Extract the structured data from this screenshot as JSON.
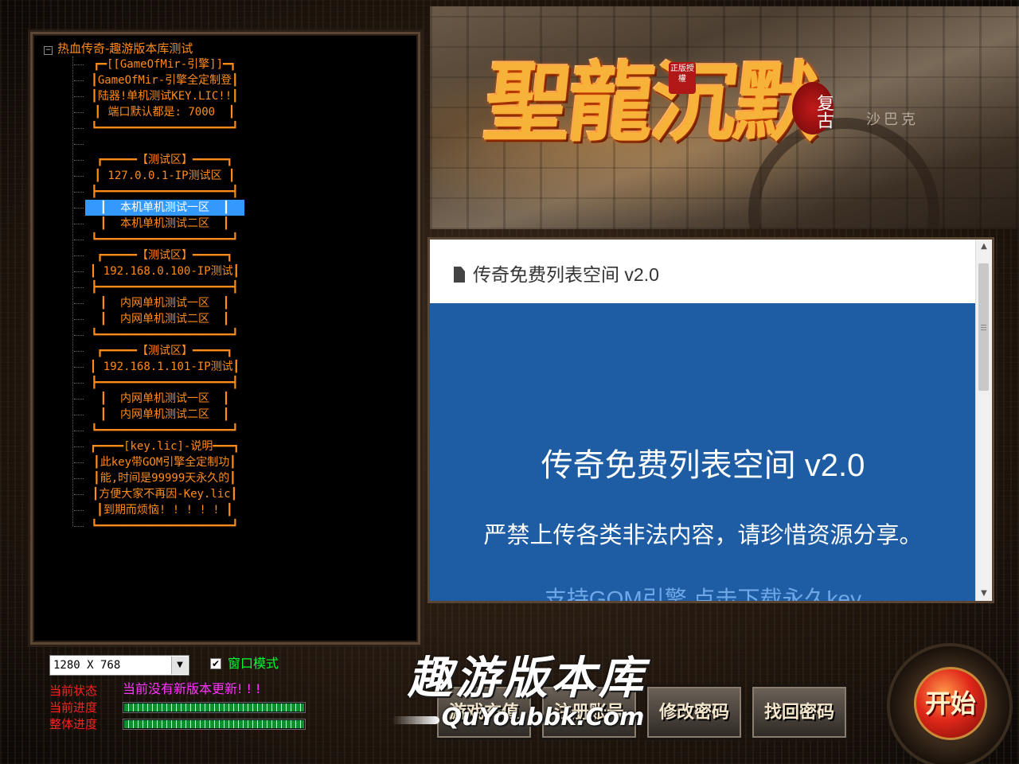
{
  "window": {
    "minimize_glyph": "◻",
    "close_glyph": "✕"
  },
  "tree": {
    "root_label": "热血传奇-趣游版本库测试",
    "expand_glyph": "−",
    "nodes": [
      "┏━[[GameOfMir-引擎]]━┓",
      "┃GameOfMir-引擎全定制登┃",
      "┃陆器!单机测试KEY.LIC!!┃",
      "┃ 端口默认都是: 7000  ┃",
      "┗━━━━━━━━━━━━━━━━━━━━┛",
      "",
      "┏━━━━━【测试区】━━━━━┓",
      "┃ 127.0.0.1-IP测试区 ┃",
      "┣━━━━━━━━━━━━━━━━━━━━┫",
      "┃  本机单机测试一区  ┃",
      "┃  本机单机测试二区  ┃",
      "┗━━━━━━━━━━━━━━━━━━━━┛",
      "┏━━━━━【测试区】━━━━━┓",
      "┃ 192.168.0.100-IP测试┃",
      "┣━━━━━━━━━━━━━━━━━━━━┫",
      "┃  内网单机测试一区  ┃",
      "┃  内网单机测试二区  ┃",
      "┗━━━━━━━━━━━━━━━━━━━━┛",
      "┏━━━━━【测试区】━━━━━┓",
      "┃ 192.168.1.101-IP测试┃",
      "┣━━━━━━━━━━━━━━━━━━━━┫",
      "┃  内网单机测试一区  ┃",
      "┃  内网单机测试二区  ┃",
      "┗━━━━━━━━━━━━━━━━━━━━┛",
      "┏━━━━[key.lic]-说明━━━┓",
      "┃此key带GOM引擎全定制功┃",
      "┃能,时间是99999天永久的┃",
      "┃方便大家不再因-Key.lic┃",
      "┃到期而烦恼! ! ! ! ! ┃",
      "┗━━━━━━━━━━━━━━━━━━━━┛"
    ],
    "selected_index": 9
  },
  "banner": {
    "game_title": "聖龍沉默",
    "title_tag": "正版授權",
    "title_sub": "复古",
    "sign_text": "沙巴克"
  },
  "web": {
    "header_title": "传奇免费列表空间 v2.0",
    "hero_title": "传奇免费列表空间 v2.0",
    "hero_subtitle": "严禁上传各类非法内容，请珍惜资源分享。",
    "hero_link": "支持GOM引擎 点击下载永久key",
    "scroll_up_glyph": "▲",
    "scroll_down_glyph": "▼"
  },
  "controls": {
    "resolution_value": "1280 X 768",
    "resolution_arrow": "▼",
    "window_mode_checked": "✔",
    "window_mode_label": "窗口模式",
    "status_label": "当前状态",
    "status_text": "当前没有新版本更新! ! !",
    "current_progress_label": "当前进度",
    "total_progress_label": "整体进度",
    "current_progress": 1.0,
    "total_progress": 1.0
  },
  "buttons": {
    "recharge": "游戏充值",
    "register": "注册账号",
    "change_password": "修改密码",
    "find_password": "找回密码",
    "start": "开始"
  },
  "watermark": {
    "cn": "趣游版本库",
    "en": "QuYoubbk.Com"
  },
  "colors": {
    "tree_text": "#ff8c1a",
    "selection": "#3399ff",
    "web_blue": "#1e5da3",
    "status_label": "#ff2020",
    "status_text": "#ff33ff",
    "window_label": "#00ff30",
    "progress_fill": "#0d8f2c"
  }
}
